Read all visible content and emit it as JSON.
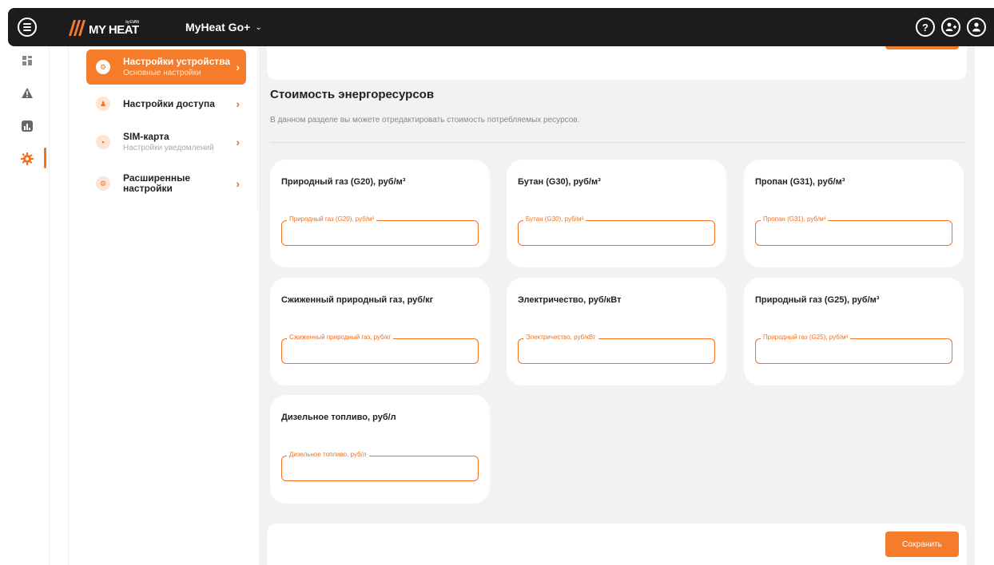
{
  "header": {
    "brand": "MY HEAT",
    "brand_sub": "by EVAN",
    "device_name": "MyHeat Go+",
    "icons": [
      "menu-icon",
      "help-icon",
      "add-user-icon",
      "profile-icon"
    ],
    "help_label": "?"
  },
  "rail": {
    "items": [
      "dashboard-icon",
      "warning-icon",
      "chart-icon",
      "settings-icon"
    ],
    "active": "settings-icon"
  },
  "settings_nav": [
    {
      "label": "Настройки устройства",
      "sub": "Основные настройки",
      "active": true
    },
    {
      "label": "Настройки доступа",
      "sub": "",
      "active": false
    },
    {
      "label": "SIM-карта",
      "sub": "Настройки уведомлений",
      "active": false
    },
    {
      "label": "Расширенные настройки",
      "sub": "",
      "active": false
    }
  ],
  "section": {
    "title": "Стоимость энергоресурсов",
    "description": "В данном разделе вы можете отредактировать стоимость потребляемых ресурсов."
  },
  "cards": [
    {
      "title": "Природный газ (G20), руб/м³",
      "label": "Природный газ (G20), руб/м³",
      "value": ""
    },
    {
      "title": "Бутан (G30), руб/м³",
      "label": "Бутан (G30), руб/м³",
      "value": ""
    },
    {
      "title": "Пропан (G31), руб/м³",
      "label": "Пропан (G31), руб/м³",
      "value": ""
    },
    {
      "title": "Сжиженный природный газ, руб/кг",
      "label": "Сжиженный природный газ, руб/кг",
      "value": ""
    },
    {
      "title": "Электричество, руб/кВт",
      "label": "Электричество, руб/кВт",
      "value": ""
    },
    {
      "title": "Природный газ (G25), руб/м³",
      "label": "Природный газ (G25), руб/м³",
      "value": ""
    },
    {
      "title": "Дизельное топливо, руб/л",
      "label": "Дизельное топливо, руб/л",
      "value": ""
    }
  ],
  "save_label": "Сохранить",
  "colors": {
    "accent": "#f47c2b",
    "topbar": "#1c1c1c",
    "main_bg": "#f2f2f4"
  }
}
